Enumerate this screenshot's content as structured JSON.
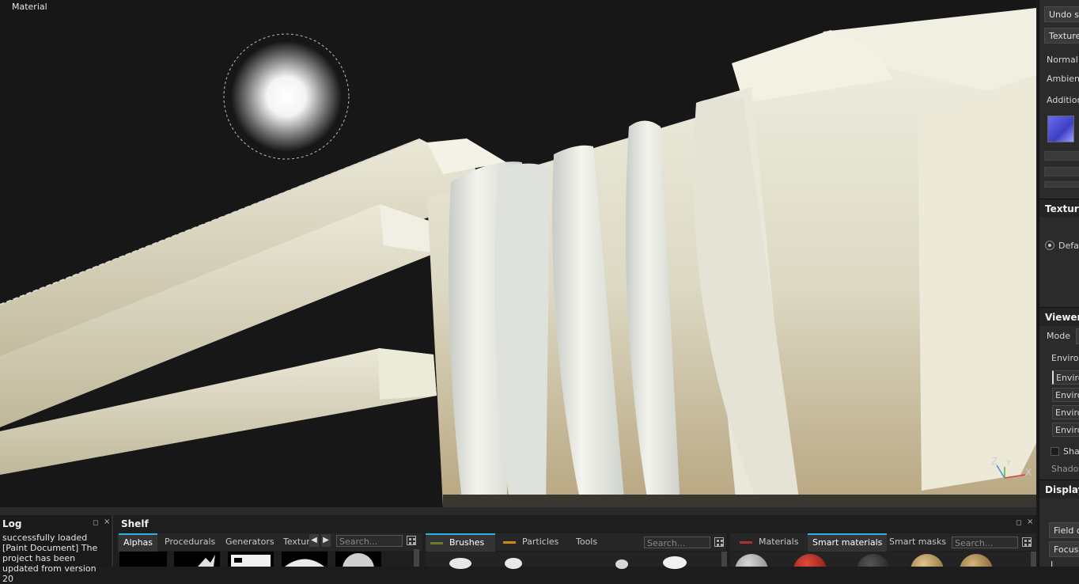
{
  "viewport": {
    "label": "Material",
    "gizmo": {
      "z": "Z",
      "y": "Y",
      "x": "X"
    }
  },
  "right_panel": {
    "undo_stack_label": "Undo st",
    "textures_button": "Texture",
    "normal_map_label": "Normal m",
    "ambient_label": "Ambient",
    "additional_label": "Additiona",
    "textures_section_title": "Texture",
    "default_option": "Defa",
    "viewer_settings_title": "Viewer S",
    "mode_label": "Mode",
    "environment_label": "Environ",
    "environment_items": [
      "Enviro",
      "Enviro",
      "Enviro",
      "Enviro"
    ],
    "shadows_checkbox": "Shac",
    "shadows_label": "Shadow",
    "display_title": "Display",
    "field_of_view": "Field of",
    "focus_label": "Focus d",
    "last_item": "L"
  },
  "log": {
    "title": "Log",
    "text": "successfully loaded [Paint Document] The project has been updated from version 20"
  },
  "shelf": {
    "title": "Shelf",
    "tabs": [
      "Alphas",
      "Procedurals",
      "Generators",
      "Textur"
    ],
    "active_tab": "Alphas",
    "search_placeholder": "Search..."
  },
  "brushes_panel": {
    "tabs": [
      "Brushes",
      "Particles",
      "Tools"
    ],
    "active_tab": "Brushes",
    "search_placeholder": "Search...",
    "colors": {
      "brushes": "#6b7a2f",
      "particles": "#d08a1a"
    }
  },
  "materials_panel": {
    "tabs": [
      "Materials",
      "Smart materials",
      "Smart masks"
    ],
    "active_tab": "Smart materials",
    "search_placeholder": "Search...",
    "colors": {
      "materials": "#b03030"
    }
  },
  "colors": {
    "accent": "#2bb0e8",
    "viewport_bg": "#171717",
    "model": "#e6e4d4"
  }
}
